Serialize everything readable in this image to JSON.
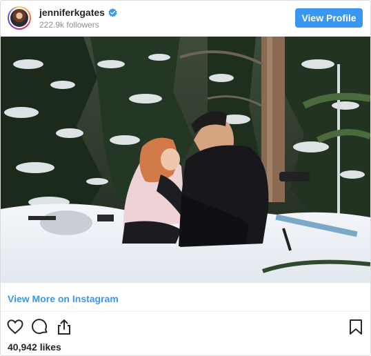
{
  "header": {
    "username": "jenniferkgates",
    "verified_icon": "verified-badge-icon",
    "followers": "222.9k followers",
    "view_profile_label": "View Profile"
  },
  "photo": {
    "subject": "couple-in-snow-photo"
  },
  "links": {
    "view_more": "View More on Instagram"
  },
  "actions": {
    "icons": [
      "heart-icon",
      "comment-icon",
      "share-icon",
      "bookmark-icon"
    ]
  },
  "likes": "40,942 likes",
  "colors": {
    "accent": "#3897f0",
    "text": "#262626",
    "muted": "#8e8e8e",
    "border": "#dbdbdb"
  }
}
